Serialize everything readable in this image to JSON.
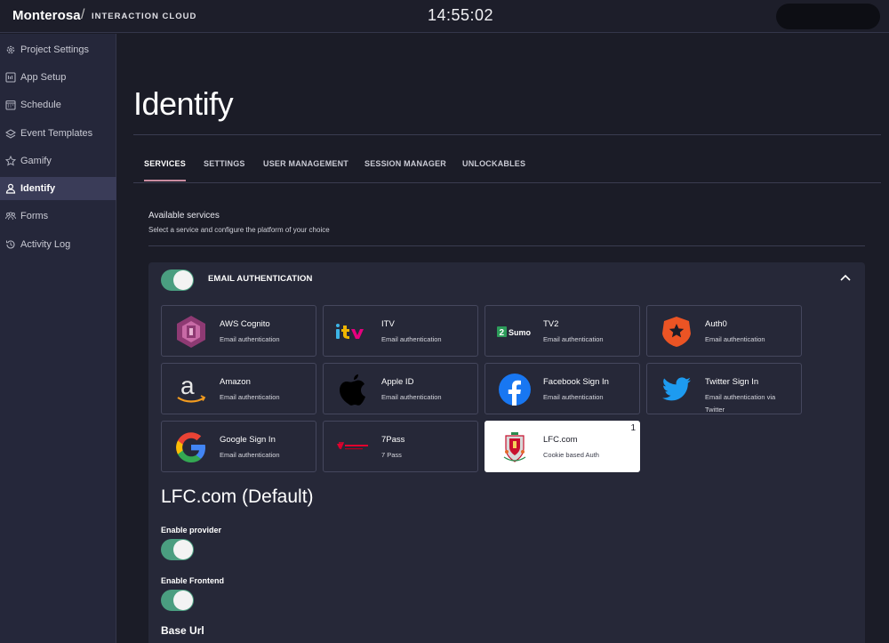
{
  "header": {
    "brand": "Monterosa",
    "brand_separator": "/",
    "product": "INTERACTION CLOUD",
    "clock": "14:55:02"
  },
  "sidebar": {
    "items": [
      {
        "label": "Project Settings",
        "icon": "gear-icon"
      },
      {
        "label": "App Setup",
        "icon": "app-icon"
      },
      {
        "label": "Schedule",
        "icon": "calendar-icon"
      },
      {
        "label": "Event Templates",
        "icon": "layers-icon"
      },
      {
        "label": "Gamify",
        "icon": "star-icon"
      },
      {
        "label": "Identify",
        "icon": "user-icon",
        "active": true
      },
      {
        "label": "Forms",
        "icon": "people-icon"
      },
      {
        "label": "Activity Log",
        "icon": "history-icon"
      }
    ]
  },
  "page": {
    "title": "Identify",
    "tabs": [
      "SERVICES",
      "SETTINGS",
      "USER MANAGEMENT",
      "SESSION MANAGER",
      "UNLOCKABLES"
    ],
    "active_tab": "SERVICES"
  },
  "services": {
    "title": "Available services",
    "subtitle": "Select a service and configure the platform of your choice",
    "panel": {
      "label": "EMAIL AUTHENTICATION",
      "enabled": true,
      "expanded": true
    },
    "cards": [
      {
        "name": "AWS Cognito",
        "desc": "Email authentication",
        "logo": "aws-cognito-logo"
      },
      {
        "name": "ITV",
        "desc": "Email authentication",
        "logo": "itv-logo"
      },
      {
        "name": "TV2",
        "desc": "Email authentication",
        "logo": "tv2-sumo-logo"
      },
      {
        "name": "Auth0",
        "desc": "Email authentication",
        "logo": "auth0-logo"
      },
      {
        "name": "Amazon",
        "desc": "Email authentication",
        "logo": "amazon-logo"
      },
      {
        "name": "Apple ID",
        "desc": "Email authentication",
        "logo": "apple-logo"
      },
      {
        "name": "Facebook Sign In",
        "desc": "Email authentication",
        "logo": "facebook-logo"
      },
      {
        "name": "Twitter Sign In",
        "desc": "Email authentication via Twitter",
        "logo": "twitter-logo"
      },
      {
        "name": "Google Sign In",
        "desc": "Email authentication",
        "logo": "google-logo"
      },
      {
        "name": "7Pass",
        "desc": "7 Pass",
        "logo": "7pass-logo"
      },
      {
        "name": "LFC.com",
        "desc": "Cookie based Auth",
        "logo": "lfc-crest-logo",
        "selected": true,
        "badge": "1"
      }
    ]
  },
  "provider": {
    "title": "LFC.com (Default)",
    "enable_provider_label": "Enable provider",
    "enable_provider": true,
    "enable_frontend_label": "Enable Frontend",
    "enable_frontend": true,
    "base_url_label": "Base Url"
  },
  "colors": {
    "background": "#1b1c27",
    "sidebar": "#25273a",
    "sidebar_active": "#3a3c58",
    "panel": "#262838",
    "toggle_on": "#4a9e80",
    "tab_underline": "#c98ca0"
  }
}
